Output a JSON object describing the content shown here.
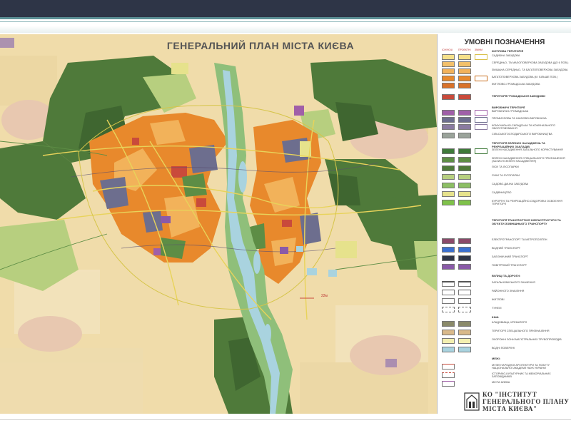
{
  "slide": {
    "map_title": "ГЕНЕРАЛЬНИЙ ПЛАН МІСТА КИЄВА",
    "map_label": "22м"
  },
  "legend": {
    "title": "УМОВНІ ПОЗНАЧЕННЯ",
    "column_heads": [
      "ІСНУЮЧІ",
      "ПРОЕКТНІ",
      "ЗМІНИ"
    ],
    "sections": [
      "ЖИТЛОВА ТЕРИТОРІЯ",
      "ТЕРИТОРІЇ ГРОМАДСЬКОЇ ЗАБУДОВИ",
      "ВИРОБНИЧІ ТЕРИТОРІЇ",
      "ТЕРИТОРІЇ ЗЕЛЕНИХ НАСАДЖЕНЬ ТА РЕКРЕАЦІЙНИХ ЗАКЛАДІВ",
      "ТЕРИТОРІЇ ТРАНСПОРТНОЇ ІНФРАСТРУКТУРИ ТА ОБ'ЄКТИ ЗОВНІШНЬОГО ТРАНСПОРТУ",
      "ВУЛИЦІ ТА ДОРОГИ:",
      "ІНШІ:",
      "МЕЖІ:"
    ],
    "items": [
      "САДИБНА ЗАБУДОВА",
      "СЕРЕДНЬО- ТА МАЛОПОВЕРХОВА ЗАБУДОВА (ДО 6 ПОВ.)",
      "ЗМІШАНА СЕРЕДНЬО- ТА БАГАТОПОВЕРХОВА ЗАБУДОВА",
      "БАГАТОПОВЕРХОВА ЗАБУДОВА (6 І БІЛЬШЕ ПОВ.)",
      "ЖИТЛОВО-ГРОМАДСЬКА ЗАБУДОВА",
      "ВИРОБНИЧО-ГРОМАДСЬКА",
      "ПРОМИСЛОВА ТА НАУКОВО-ВИРОБНИЧА",
      "КОМУНАЛЬНО-СКЛАДСЬКА ТА КОМУНАЛЬНОГО ОБСЛУГОВУВАННЯ",
      "СІЛЬСЬКОГОСПОДАРСЬКОГО ВИРОБНИЦТВА",
      "ЗЕЛЕНІ НАСАДЖЕННЯ ЗАГАЛЬНОГО КОРИСТУВАННЯ",
      "ЗЕЛЕНІ НАСАДЖЕННЯ СПЕЦІАЛЬНОГО ПРИЗНАЧЕННЯ (ЗАХИСНІ ЗЕЛЕНІ НАСАДЖЕННЯ)",
      "ЛІСИ ТА ЛІСОПАРКИ",
      "ЛУКИ ТА ЛУГОПАРКИ",
      "САДОВО-ДАЧНА ЗАБУДОВА",
      "САДІВНИЦТВО",
      "КУРОРТНІ ТА РЕКРЕАЦІЙНО-ОЗДОРОВЧІ ОСВОЄННЯ ТЕРИТОРІЇ",
      "ЕЛЕКТРОТРАНСПОРТ ТА МЕТРОПОЛІТЕН",
      "ВОДНИЙ ТРАНСПОРТ",
      "ЗАЛІЗНИЧНИЙ ТРАНСПОРТ",
      "ПОВІТРЯНИЙ ТРАНСПОРТ",
      "ЗАГАЛЬНОМІСЬКОГО ЗНАЧЕННЯ",
      "РАЙОННОГО ЗНАЧЕННЯ",
      "ЖИТЛОВІ",
      "ТУНЕЛІ",
      "КЛАДОВИЩА, КРЕМАТОРІЇ",
      "ТЕРИТОРІЇ СПЕЦІАЛЬНОГО ПРИЗНАЧЕННЯ",
      "ОХОРОННІ ЗОНИ МАГІСТРАЛЬНИХ ТРУБОПРОВОДІВ",
      "ВОДНІ ПОВЕРХНІ",
      "МУЗЕЇ НАРОДНОЇ АРХІТЕКТУРИ ТА ПОБУТУ НАЦІОНАЛЬНОЇ АКАДЕМІЇ НАУК УКРАЇНИ",
      "ІСТОРИКО-КУЛЬТУРНИХ ТА МЕМОРІАЛЬНИХ ЗАПОВІДНИКІВ",
      "МІСТА КИЄВА"
    ]
  },
  "institute": {
    "line1": "КО \"ІНСТИТУТ",
    "line2": "ГЕНЕРАЛЬНОГО ПЛАНУ",
    "line3": "МІСТА КИЄВА\""
  },
  "colors": {
    "forest": "#4f7a3a",
    "forest_dark": "#3f6630",
    "meadow": "#b7cf7f",
    "farmland": "#f0dcaa",
    "farmland_light": "#f5e8c8",
    "residential_orange": "#e8892c",
    "residential_light": "#f2b25a",
    "industrial": "#6d6e8e",
    "public": "#c94a3b",
    "water": "#a9d3df",
    "river_green": "#8fbf7a",
    "dacha": "#e6e28c",
    "road": "#e8d35a"
  }
}
